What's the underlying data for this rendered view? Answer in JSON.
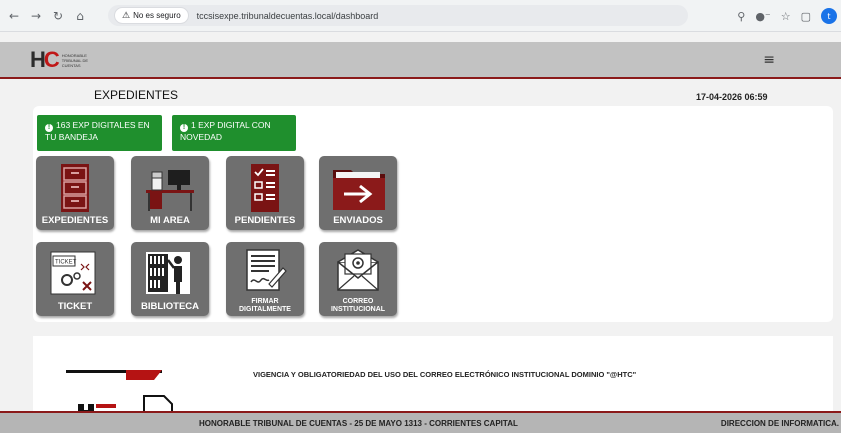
{
  "browser": {
    "security_label": "No es seguro",
    "url": "tccsisexpe.tribunaldecuentas.local/dashboard",
    "profile_initial": "t"
  },
  "header": {
    "logo_text": "HONORABLE TRIBUNAL DE CUENTAS"
  },
  "page": {
    "title": "EXPEDIENTES",
    "datetime": "17-04-2026 06:59"
  },
  "alerts": [
    {
      "text": "163 EXP DIGITALES EN TU BANDEJA"
    },
    {
      "text": "1 EXP DIGITAL CON NOVEDAD"
    }
  ],
  "tiles": {
    "expedientes": "EXPEDIENTES",
    "mi_area": "MI AREA",
    "pendientes": "PENDIENTES",
    "enviados": "ENVIADOS",
    "ticket": "TICKET",
    "biblioteca": "BIBLIOTECA",
    "firmar_1": "FIRMAR",
    "firmar_2": "DIGITALMENTE",
    "correo_1": "CORREO",
    "correo_2": "INSTITUCIONAL",
    "ticket_icon_text": "TICKET"
  },
  "news": {
    "heading": "VIGENCIA Y OBLIGATORIEDAD DEL USO DEL CORREO ELECTRÓNICO INSTITUCIONAL DOMINIO \"@HTC\""
  },
  "footer": {
    "center": "HONORABLE TRIBUNAL DE CUENTAS - 25 DE MAYO 1313 - CORRIENTES CAPITAL",
    "right": "DIRECCION DE INFORMATICA."
  }
}
